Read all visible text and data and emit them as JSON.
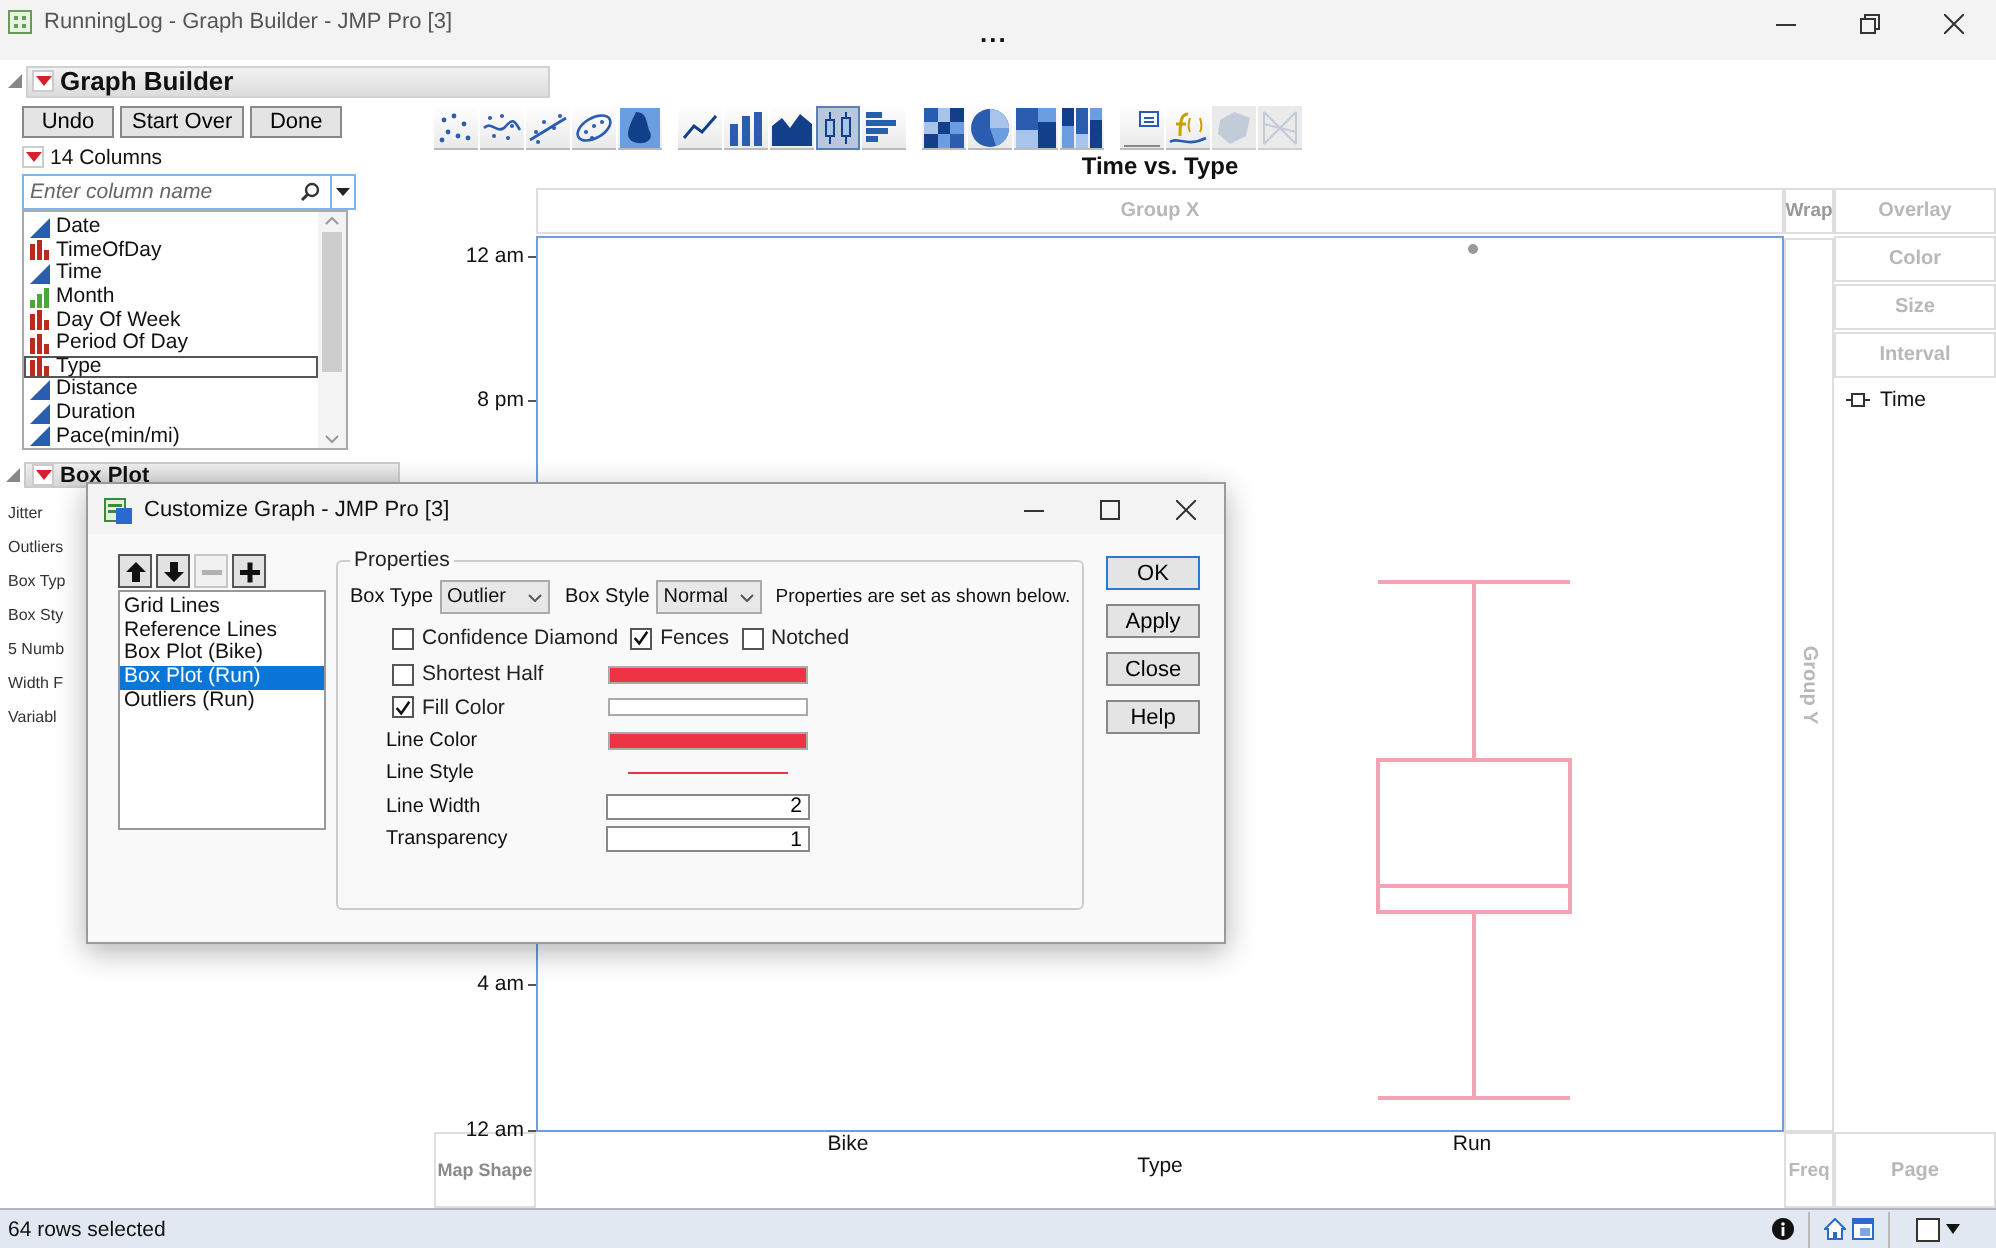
{
  "window": {
    "title": "RunningLog - Graph Builder - JMP Pro [3]",
    "more": "..."
  },
  "graph_builder": {
    "title": "Graph Builder",
    "buttons": [
      "Undo",
      "Start Over",
      "Done"
    ],
    "columns_count": "14 Columns",
    "search": {
      "placeholder": "Enter column name"
    },
    "columns": [
      {
        "name": "Date",
        "kind": "continuous",
        "focused": false
      },
      {
        "name": "TimeOfDay",
        "kind": "nominal",
        "focused": false
      },
      {
        "name": "Time",
        "kind": "continuous",
        "focused": false
      },
      {
        "name": "Month",
        "kind": "ordinal",
        "focused": false
      },
      {
        "name": "Day Of Week",
        "kind": "nominal",
        "focused": false
      },
      {
        "name": "Period Of Day",
        "kind": "nominal",
        "focused": false
      },
      {
        "name": "Type",
        "kind": "nominal",
        "focused": true
      },
      {
        "name": "Distance",
        "kind": "continuous",
        "focused": false
      },
      {
        "name": "Duration",
        "kind": "continuous",
        "focused": false
      },
      {
        "name": "Pace(min/mi)",
        "kind": "continuous",
        "focused": false
      }
    ],
    "box_plot": {
      "title": "Box Plot",
      "labels": [
        "Jitter",
        "Outliers",
        "Box Typ",
        "Box Sty",
        "5 Numb",
        "Width F",
        "Variabl"
      ]
    }
  },
  "toolbar": [
    {
      "kind": "points",
      "selected": false,
      "disabled": false
    },
    {
      "kind": "smoother",
      "selected": false,
      "disabled": false
    },
    {
      "kind": "line_fit",
      "selected": false,
      "disabled": false
    },
    {
      "kind": "ellipse",
      "selected": false,
      "disabled": false
    },
    {
      "kind": "contour",
      "selected": false,
      "disabled": false
    },
    {
      "kind": "line",
      "selected": false,
      "disabled": false
    },
    {
      "kind": "bar",
      "selected": false,
      "disabled": false
    },
    {
      "kind": "area",
      "selected": false,
      "disabled": false
    },
    {
      "kind": "box_plot",
      "selected": true,
      "disabled": false
    },
    {
      "kind": "histogram",
      "selected": false,
      "disabled": false
    },
    {
      "kind": "heatmap",
      "selected": false,
      "disabled": false
    },
    {
      "kind": "pie",
      "selected": false,
      "disabled": false
    },
    {
      "kind": "treemap",
      "selected": false,
      "disabled": false
    },
    {
      "kind": "mosaic",
      "selected": false,
      "disabled": false
    },
    {
      "kind": "caption",
      "selected": false,
      "disabled": false
    },
    {
      "kind": "formula",
      "selected": false,
      "disabled": false
    },
    {
      "kind": "map_shape",
      "selected": false,
      "disabled": true
    },
    {
      "kind": "parallel",
      "selected": false,
      "disabled": true
    }
  ],
  "graph": {
    "title": "Time vs. Type",
    "group_x": "Group X",
    "wrap": "Wrap",
    "group_y": "Group Y",
    "zones": [
      "Overlay",
      "Color",
      "Size",
      "Interval"
    ],
    "legend": [
      {
        "label": "Time"
      }
    ],
    "y_ticks": [
      "12 am",
      "8 pm",
      "4 am",
      "12 am"
    ],
    "x_categories": [
      "Bike",
      "Run"
    ],
    "x_title": "Type",
    "map_shape": "Map Shape",
    "freq": "Freq",
    "page": "Page"
  },
  "dialog": {
    "title": "Customize Graph - JMP Pro [3]",
    "list_buttons": [
      {
        "kind": "up",
        "disabled": false
      },
      {
        "kind": "down",
        "disabled": false
      },
      {
        "kind": "remove",
        "disabled": true
      },
      {
        "kind": "add",
        "disabled": false
      }
    ],
    "items": [
      {
        "label": "Grid Lines",
        "selected": false
      },
      {
        "label": "Reference Lines",
        "selected": false
      },
      {
        "label": "Box Plot (Bike)",
        "selected": false
      },
      {
        "label": "Box Plot (Run)",
        "selected": true
      },
      {
        "label": "Outliers (Run)",
        "selected": false
      }
    ],
    "properties": {
      "title": "Properties",
      "box_type": {
        "label": "Box Type",
        "value": "Outlier"
      },
      "box_style": {
        "label": "Box Style",
        "value": "Normal"
      },
      "note": "Properties are set as shown below.",
      "checks": [
        {
          "label": "Confidence Diamond",
          "checked": false
        },
        {
          "label": "Fences",
          "checked": true
        },
        {
          "label": "Notched",
          "checked": false
        }
      ],
      "rows": [
        {
          "kind": "check_swatch",
          "label": "Shortest Half",
          "checked": false,
          "color": "#ee3344"
        },
        {
          "kind": "check_swatch",
          "label": "Fill Color",
          "checked": true,
          "color": "#ffffff"
        },
        {
          "kind": "swatch",
          "label": "Line Color",
          "color": "#ee3344"
        },
        {
          "kind": "line",
          "label": "Line Style",
          "color": "#ee3344"
        },
        {
          "kind": "number",
          "label": "Line Width",
          "value": "2"
        },
        {
          "kind": "number",
          "label": "Transparency",
          "value": "1"
        }
      ]
    },
    "buttons": [
      {
        "label": "OK",
        "default": true
      },
      {
        "label": "Apply",
        "default": false
      },
      {
        "label": "Close",
        "default": false
      },
      {
        "label": "Help",
        "default": false
      }
    ]
  },
  "status_bar": {
    "text": "64 rows selected",
    "checkbox": {
      "checked": false
    }
  }
}
